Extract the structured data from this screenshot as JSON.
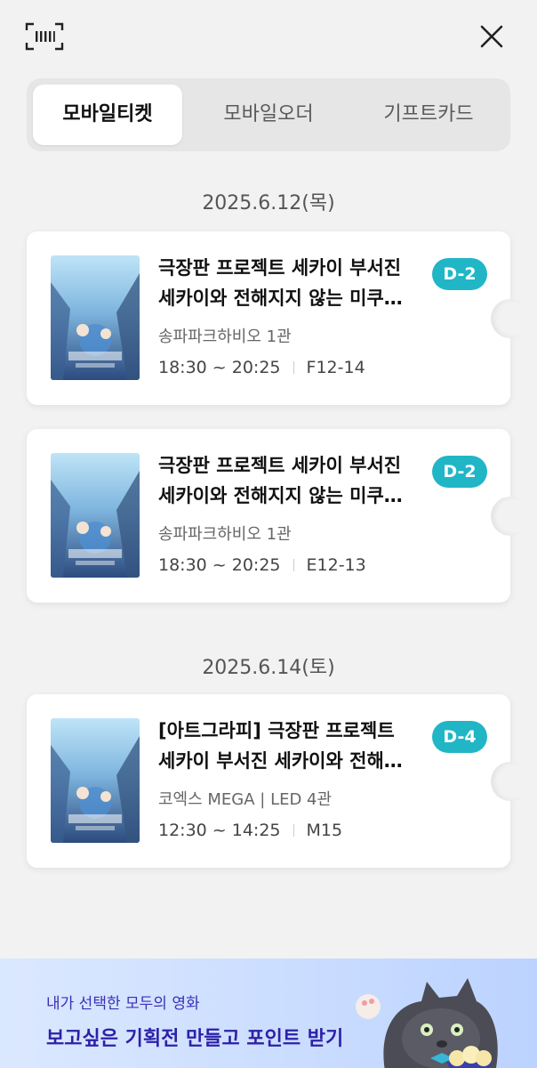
{
  "tabs": [
    {
      "label": "모바일티켓",
      "active": true
    },
    {
      "label": "모바일오더",
      "active": false
    },
    {
      "label": "기프트카드",
      "active": false
    }
  ],
  "groups": [
    {
      "date": "2025.6.12(목)"
    },
    {
      "date": "2025.6.14(토)"
    }
  ],
  "tickets": [
    {
      "title_line1": "극장판 프로젝트 세카이 부서진",
      "title_line2": "세카이와 전해지지 않는 미쿠…",
      "theater": "송파파크하비오 1관",
      "time": "18:30 ~ 20:25",
      "seat": "F12-14",
      "dday": "D-2"
    },
    {
      "title_line1": "극장판 프로젝트 세카이 부서진",
      "title_line2": "세카이와 전해지지 않는 미쿠…",
      "theater": "송파파크하비오 1관",
      "time": "18:30 ~ 20:25",
      "seat": "E12-13",
      "dday": "D-2"
    },
    {
      "title_line1": "[아트그라피] 극장판 프로젝트",
      "title_line2": "세카이 부서진 세카이와 전해…",
      "theater": "코엑스 MEGA | LED 4관",
      "time": "12:30 ~ 14:25",
      "seat": "M15",
      "dday": "D-4"
    }
  ],
  "banner": {
    "subtitle": "내가 선택한 모두의 영화",
    "title": "보고싶은 기획전 만들고 포인트 받기"
  },
  "icons": {
    "scan": "barcode-scan-icon",
    "close": "close-icon"
  },
  "colors": {
    "accent": "#21b6c6",
    "banner_text": "#2d20a8"
  }
}
